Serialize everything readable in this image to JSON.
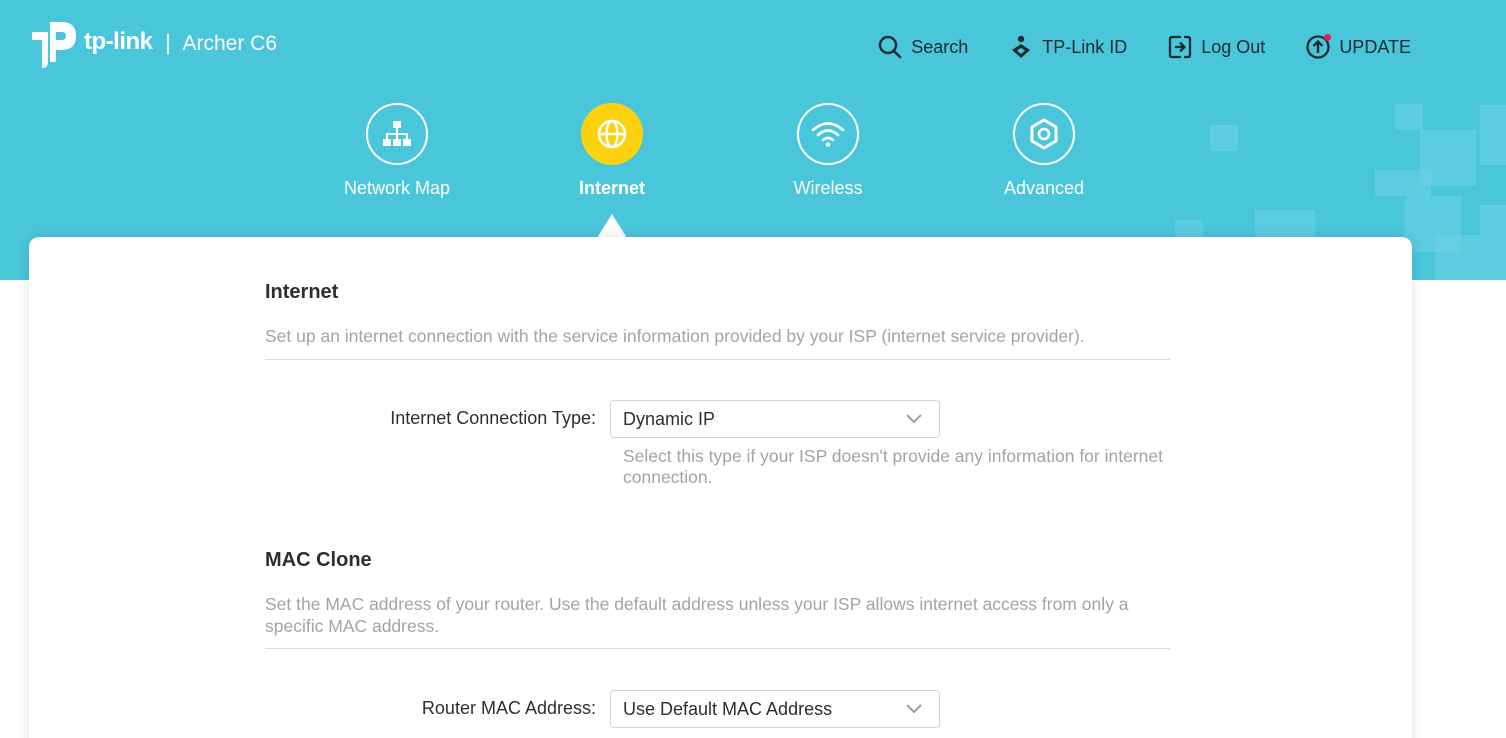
{
  "header": {
    "brand": "tp-link",
    "model": "Archer C6",
    "links": {
      "search": "Search",
      "tplink_id": "TP-Link ID",
      "logout": "Log Out",
      "update": "UPDATE"
    }
  },
  "nav": {
    "tabs": [
      {
        "label": "Network Map",
        "icon": "network-map-icon"
      },
      {
        "label": "Internet",
        "icon": "globe-icon",
        "active": true
      },
      {
        "label": "Wireless",
        "icon": "wifi-icon"
      },
      {
        "label": "Advanced",
        "icon": "gear-icon"
      }
    ]
  },
  "internet": {
    "title": "Internet",
    "description": "Set up an internet connection with the service information provided by your ISP (internet service provider).",
    "connection_type_label": "Internet Connection Type:",
    "connection_type_value": "Dynamic IP",
    "connection_type_hint": "Select this type if your ISP doesn't provide any information for internet connection."
  },
  "mac_clone": {
    "title": "MAC Clone",
    "description": "Set the MAC address of your router. Use the default address unless your ISP allows internet access from only a specific MAC address.",
    "router_mac_label": "Router MAC Address:",
    "router_mac_value": "Use Default MAC Address"
  },
  "colors": {
    "banner": "#4ac6db",
    "active_tab": "#fcd20f",
    "update_dot": "#e8175d"
  }
}
